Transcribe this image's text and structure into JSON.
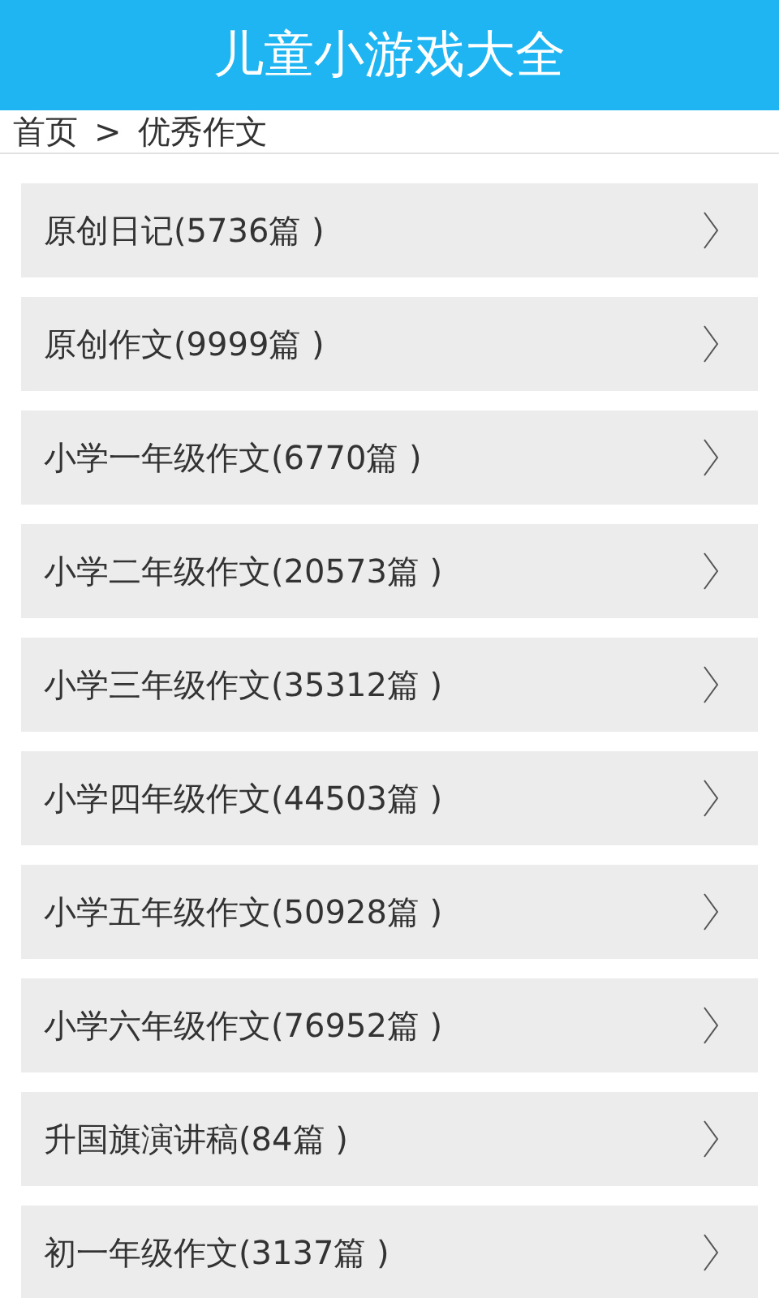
{
  "header": {
    "title": "儿童小游戏大全"
  },
  "breadcrumb": {
    "home": "首页",
    "separator": ">",
    "current": "优秀作文"
  },
  "categories": [
    {
      "label": "原创日记(5736篇 )"
    },
    {
      "label": "原创作文(9999篇 )"
    },
    {
      "label": "小学一年级作文(6770篇 )"
    },
    {
      "label": "小学二年级作文(20573篇 )"
    },
    {
      "label": "小学三年级作文(35312篇 )"
    },
    {
      "label": "小学四年级作文(44503篇 )"
    },
    {
      "label": "小学五年级作文(50928篇 )"
    },
    {
      "label": "小学六年级作文(76952篇 )"
    },
    {
      "label": "升国旗演讲稿(84篇 )"
    },
    {
      "label": "初一年级作文(3137篇 )"
    }
  ]
}
